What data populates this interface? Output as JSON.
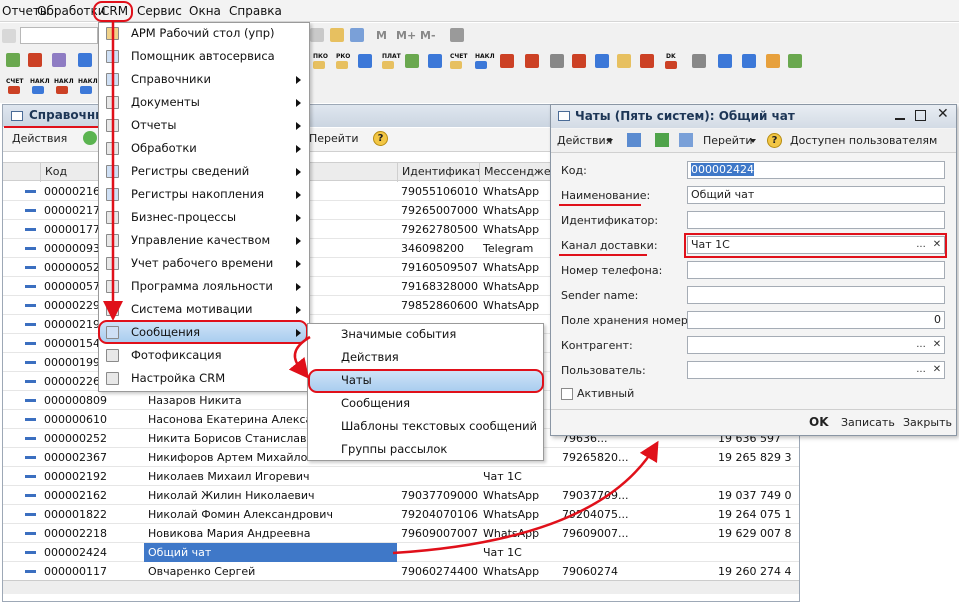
{
  "menubar": {
    "items": [
      "Отчеты",
      "Обработки",
      "CRM",
      "Сервис",
      "Окна",
      "Справка"
    ]
  },
  "toolbar": {
    "row1_labels": [
      "M",
      "M+",
      "M-"
    ],
    "row2_tiny_labels": [
      "ПКО",
      "РКО",
      "ПЛАТ",
      "СЧЕТ",
      "НАКЛ",
      "DK"
    ],
    "row3_tiny_labels": [
      "СЧЕТ",
      "НАКЛ",
      "НАКЛ",
      "НАКЛ"
    ]
  },
  "list_window": {
    "title": "Справочник",
    "actions_label": "Действия",
    "goto_label": "Перейти",
    "columns": [
      "Код",
      "",
      "Идентификат...",
      "Мессенджер",
      "",
      "",
      ""
    ],
    "rows": [
      {
        "code": "00000216",
        "name": "андрович",
        "ident": "79055106010...",
        "messenger": "WhatsApp",
        "c5": "",
        "c6": ""
      },
      {
        "code": "00000217",
        "name": "",
        "ident": "79265007000...",
        "messenger": "WhatsApp",
        "c5": "",
        "c6": ""
      },
      {
        "code": "00000177",
        "name": "",
        "ident": "79262780500...",
        "messenger": "WhatsApp",
        "c5": "",
        "c6": ""
      },
      {
        "code": "00000093",
        "name": "",
        "ident": "346098200",
        "messenger": "Telegram",
        "c5": "",
        "c6": ""
      },
      {
        "code": "00000052",
        "name": "",
        "ident": "79160509507...",
        "messenger": "WhatsApp",
        "c5": "",
        "c6": ""
      },
      {
        "code": "00000057",
        "name": "",
        "ident": "79168328000...",
        "messenger": "WhatsApp",
        "c5": "",
        "c6": ""
      },
      {
        "code": "00000229",
        "name": "",
        "ident": "79852860600...",
        "messenger": "WhatsApp",
        "c5": "",
        "c6": ""
      },
      {
        "code": "00000219",
        "name": "",
        "ident": "",
        "messenger": "",
        "c5": "",
        "c6": ""
      },
      {
        "code": "00000154",
        "name": "",
        "ident": "",
        "messenger": "",
        "c5": "",
        "c6": ""
      },
      {
        "code": "00000199",
        "name": "",
        "ident": "",
        "messenger": "",
        "c5": "",
        "c6": ""
      },
      {
        "code": "00000226",
        "name": "",
        "ident": "",
        "messenger": "",
        "c5": "",
        "c6": ""
      },
      {
        "code": "000000809",
        "name": "Назаров Никита",
        "ident": "",
        "messenger": "",
        "c5": "",
        "c6": ""
      },
      {
        "code": "000000610",
        "name": "Насонова Екатерина Александ...",
        "ident": "",
        "messenger": "",
        "c5": "",
        "c6": ""
      },
      {
        "code": "000000252",
        "name": "Никита Борисов Станиславович",
        "ident": "",
        "messenger": "",
        "c5": "79636...",
        "c6": "19 636 597"
      },
      {
        "code": "000002367",
        "name": "Никифоров Артем Михайлович",
        "ident": "",
        "messenger": "",
        "c5": "79265820...",
        "c6": "19 265 829 3"
      },
      {
        "code": "000002192",
        "name": "Николаев Михаил Игоревич",
        "ident": "",
        "messenger": "Чат 1С",
        "c5": "",
        "c6": ""
      },
      {
        "code": "000002162",
        "name": "Николай Жилин Николаевич",
        "ident": "79037709000...",
        "messenger": "WhatsApp",
        "c5": "79037709...",
        "c6": "19 037 749 0"
      },
      {
        "code": "000001822",
        "name": "Николай Фомин Александрович",
        "ident": "79204070106...",
        "messenger": "WhatsApp",
        "c5": "79204075...",
        "c6": "19 264 075 1"
      },
      {
        "code": "000002218",
        "name": "Новикова Мария Андреевна",
        "ident": "79609007007...",
        "messenger": "WhatsApp",
        "c5": "79609007...",
        "c6": "19 629 007 8"
      },
      {
        "code": "000002424",
        "name": "Общий чат",
        "ident": "",
        "messenger": "Чат 1С",
        "c5": "",
        "c6": ""
      },
      {
        "code": "000000117",
        "name": "Овчаренко Сергей",
        "ident": "79060274400",
        "messenger": "WhatsApp",
        "c5": "79060274",
        "c6": "19 260 274 4"
      }
    ]
  },
  "crm_menu": {
    "items": [
      "АРМ Рабочий стол (упр)",
      "Помощник автосервиса",
      "Справочники",
      "Документы",
      "Отчеты",
      "Обработки",
      "Регистры сведений",
      "Регистры накопления",
      "Бизнес-процессы",
      "Управление качеством",
      "Учет рабочего времени",
      "Программа лояльности",
      "Система мотивации",
      "Сообщения",
      "Фотофиксация",
      "Настройка CRM"
    ]
  },
  "submenu": {
    "items": [
      "Значимые события",
      "Действия",
      "Чаты",
      "Сообщения",
      "Шаблоны текстовых сообщений",
      "Группы рассылок"
    ]
  },
  "dialog": {
    "title": "Чаты (Пять систем): Общий чат",
    "actions_label": "Действия",
    "goto_label": "Перейти",
    "available_label": "Доступен пользователям",
    "fields": {
      "code_label": "Код:",
      "code_value": "000002424",
      "name_label": "Наименование:",
      "name_value": "Общий чат",
      "ident_label": "Идентификатор:",
      "ident_value": "",
      "channel_label": "Канал доставки:",
      "channel_value": "Чат 1С",
      "phone_label": "Номер телефона:",
      "sender_label": "Sender name:",
      "storage_label": "Поле хранения номера:",
      "storage_value": "0",
      "contractor_label": "Контрагент:",
      "user_label": "Пользователь:",
      "active_label": "Активный"
    },
    "footer": {
      "ok": "OK",
      "save": "Записать",
      "close": "Закрыть"
    }
  },
  "colors": {
    "accent_red": "#e0101a",
    "highlight_blue": "#a9cdef",
    "selection": "#3f78c8"
  }
}
